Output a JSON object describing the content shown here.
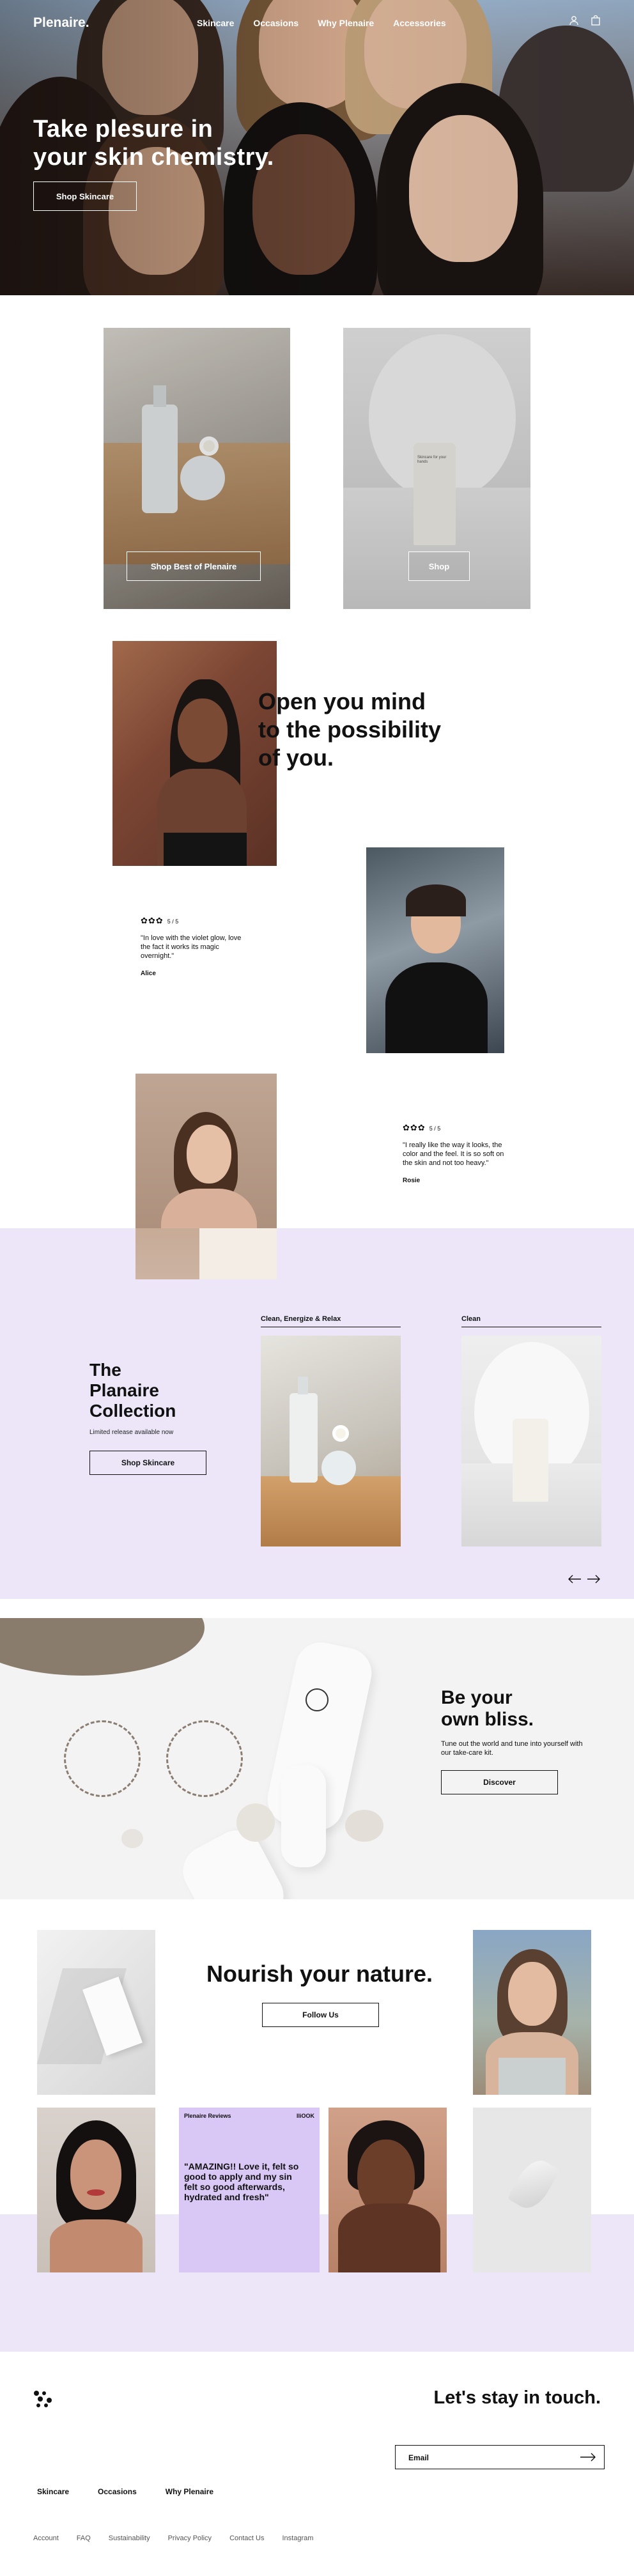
{
  "nav": {
    "logo": "Plenaire.",
    "links": [
      "Skincare",
      "Occasions",
      "Why Plenaire",
      "Accessories"
    ],
    "icons": [
      "user-icon",
      "bag-icon"
    ]
  },
  "hero": {
    "title_line1": "Take plesure in",
    "title_line2": "your skin chemistry.",
    "cta": "Shop Skincare"
  },
  "products": {
    "left_cta": "Shop Best of Plenaire",
    "right_cta": "Shop",
    "tube_label": "Skincare for your hands"
  },
  "quote": {
    "line1": "Open you mind",
    "line2": "to the possibility",
    "line3": "of you."
  },
  "reviews": [
    {
      "score": "5 / 5",
      "text": "\"In love with the violet glow, love the fact it works its magic overnight.\"",
      "author": "Alice"
    },
    {
      "score": "5 / 5",
      "text": "\"I really like the way it looks, the color and the feel. It is so soft on the skin and not too heavy.\"",
      "author": "Rosie"
    }
  ],
  "collection": {
    "title_line1": "The",
    "title_line2": "Planaire",
    "title_line3": "Collection",
    "subtitle": "Limited release available now",
    "cta": "Shop Skincare",
    "tabs": [
      "Clean, Energize & Relax",
      "Clean"
    ]
  },
  "bliss": {
    "title_line1": "Be your",
    "title_line2": "own bliss.",
    "subtitle": "Tune out the world and tune into yourself with our take-care kit.",
    "cta": "Discover"
  },
  "nourish": {
    "title": "Nourish your nature.",
    "cta": "Follow Us",
    "review_header": "Plenaire Reviews",
    "review_handle": "IliOOK",
    "review_quote": "\"AMAZING!! Love it, felt so good to apply and my sin felt so good afterwards, hydrated and fresh\""
  },
  "footer": {
    "title": "Let's stay in touch.",
    "email_label": "Email",
    "main_links": [
      "Skincare",
      "Occasions",
      "Why Plenaire"
    ],
    "sub_links": [
      "Account",
      "FAQ",
      "Sustainability",
      "Privacy Policy",
      "Contact Us",
      "Instagram"
    ]
  },
  "colors": {
    "lavender": "#ece6f8",
    "review_tile": "#d9c8f6",
    "ink": "#111111"
  }
}
